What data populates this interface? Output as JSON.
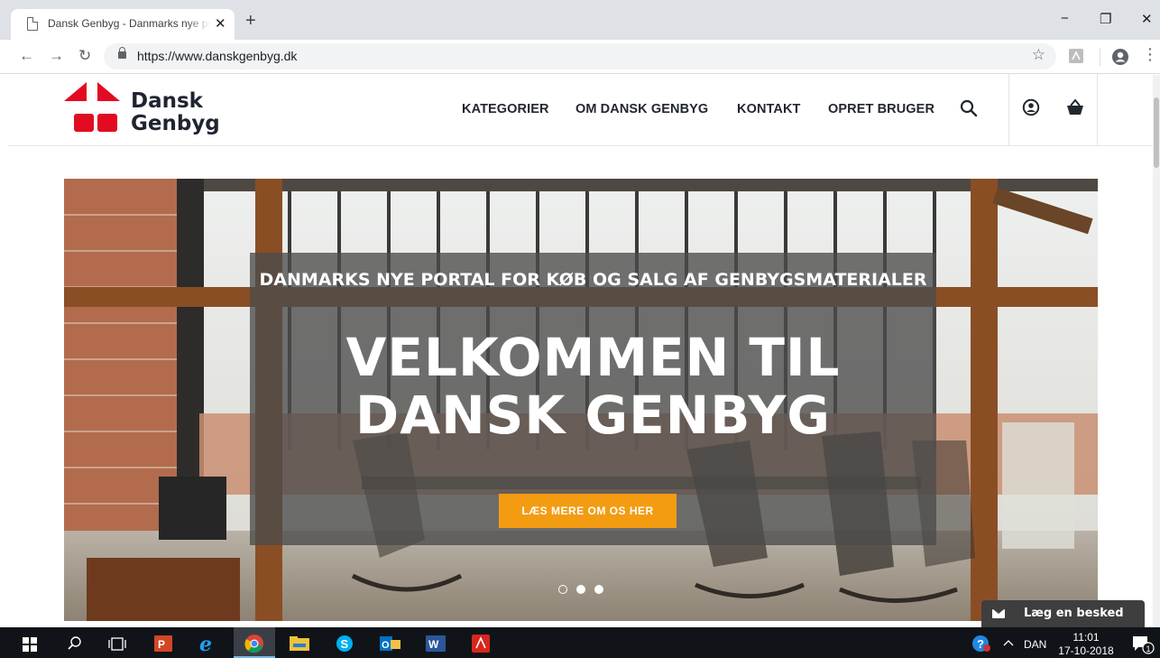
{
  "browser": {
    "tab_title": "Dansk Genbyg - Danmarks nye portal for køb og salg af genbygsmaterialer",
    "tab_close": "✕",
    "new_tab": "+",
    "minimize": "−",
    "restore": "❐",
    "close": "✕",
    "back": "←",
    "forward": "→",
    "reload": "↻",
    "url": "https://www.danskgenbyg.dk",
    "bookmark": "☆",
    "menu": "⋮"
  },
  "site": {
    "logo_line1": "Dansk",
    "logo_line2": "Genbyg",
    "nav": [
      "KATEGORIER",
      "OM DANSK GENBYG",
      "KONTAKT",
      "OPRET BRUGER"
    ]
  },
  "hero": {
    "subtitle": "DANMARKS NYE PORTAL FOR KØB OG SALG AF GENBYGSMATERIALER",
    "title_line1": "VELKOMMEN TIL",
    "title_line2": "DANSK GENBYG",
    "cta": "LÆS MERE OM OS HER",
    "slides": 3,
    "active_slide": 2
  },
  "chat": {
    "label": "Læg en besked"
  },
  "taskbar": {
    "lang": "DAN",
    "time": "11:01",
    "date": "17-10-2018",
    "notifications": "1"
  },
  "colors": {
    "brand_red": "#e30b21",
    "cta_orange": "#f39c12"
  }
}
